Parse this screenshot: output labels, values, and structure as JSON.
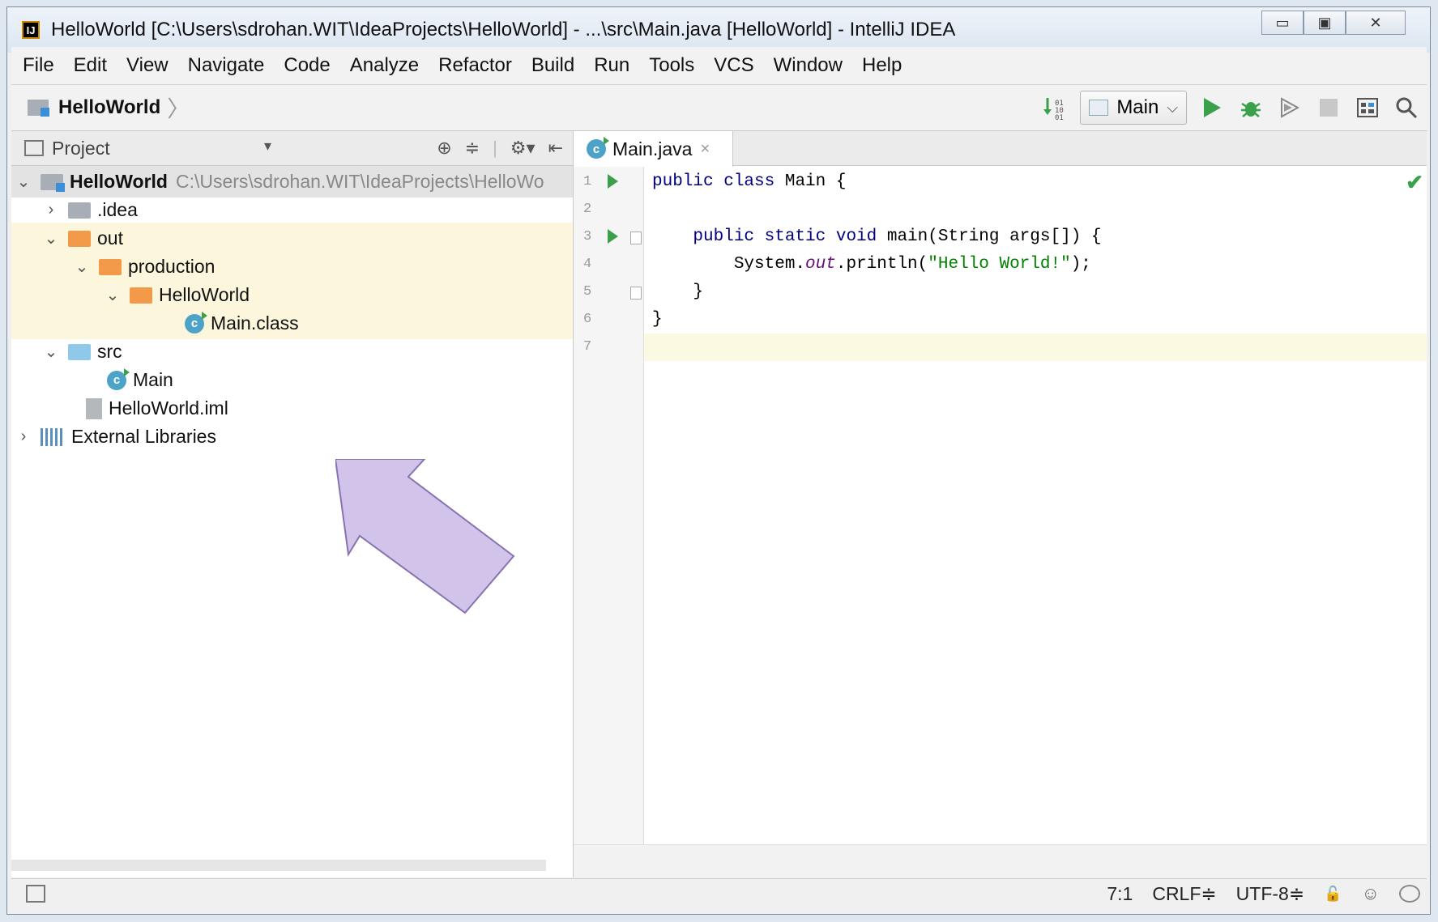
{
  "window": {
    "title": "HelloWorld [C:\\Users\\sdrohan.WIT\\IdeaProjects\\HelloWorld] - ...\\src\\Main.java [HelloWorld] - IntelliJ IDEA",
    "app_icon": "IJ",
    "controls": {
      "minimize": "▭",
      "maximize": "▣",
      "close": "✕"
    }
  },
  "menu": [
    "File",
    "Edit",
    "View",
    "Navigate",
    "Code",
    "Analyze",
    "Refactor",
    "Build",
    "Run",
    "Tools",
    "VCS",
    "Window",
    "Help"
  ],
  "navbar": {
    "breadcrumb": "HelloWorld",
    "run_config": "Main",
    "icons": [
      "sort-binary-icon",
      "run-icon",
      "debug-icon",
      "coverage-icon",
      "stop-icon",
      "project-structure-icon",
      "search-icon"
    ]
  },
  "project_panel": {
    "title": "Project",
    "tree": [
      {
        "label": "HelloWorld",
        "path": "C:\\Users\\sdrohan.WIT\\IdeaProjects\\HelloWo",
        "arrow": "⌄",
        "icon": "module-folder",
        "bold": true
      },
      {
        "label": ".idea",
        "arrow": "›",
        "icon": "gray-folder"
      },
      {
        "label": "out",
        "arrow": "⌄",
        "icon": "orange-folder"
      },
      {
        "label": "production",
        "arrow": "⌄",
        "icon": "orange-folder"
      },
      {
        "label": "HelloWorld",
        "arrow": "⌄",
        "icon": "orange-folder"
      },
      {
        "label": "Main.class",
        "arrow": "",
        "icon": "class-file"
      },
      {
        "label": "src",
        "arrow": "⌄",
        "icon": "blue-folder"
      },
      {
        "label": "Main",
        "arrow": "",
        "icon": "class"
      },
      {
        "label": "HelloWorld.iml",
        "arrow": "",
        "icon": "iml-file"
      },
      {
        "label": "External Libraries",
        "arrow": "›",
        "icon": "libraries"
      }
    ]
  },
  "editor": {
    "tab": {
      "label": "Main.java",
      "close": "×"
    },
    "line_numbers": [
      "1",
      "2",
      "3",
      "4",
      "5",
      "6",
      "7"
    ],
    "current_line": 7,
    "code": {
      "l1_kw": "public class",
      "l1_rest": " Main {",
      "l3_kw": "    public static void",
      "l3_rest": " main(String args[]) {",
      "l4_pre": "        System.",
      "l4_field": "out",
      "l4_mid": ".println(",
      "l4_str": "\"Hello World!\"",
      "l4_end": ");",
      "l5": "    }",
      "l6": "}"
    },
    "status_check": "✔"
  },
  "statusbar": {
    "position": "7:1",
    "line_separator": "CRLF≑",
    "encoding": "UTF-8≑"
  },
  "colors": {
    "highlight_rows": "#fbf6dc",
    "arrow_fill": "#cdbde8",
    "arrow_stroke": "#7a64a8",
    "keyword": "#000080",
    "string": "#008000",
    "run_green": "#3aa14a"
  }
}
